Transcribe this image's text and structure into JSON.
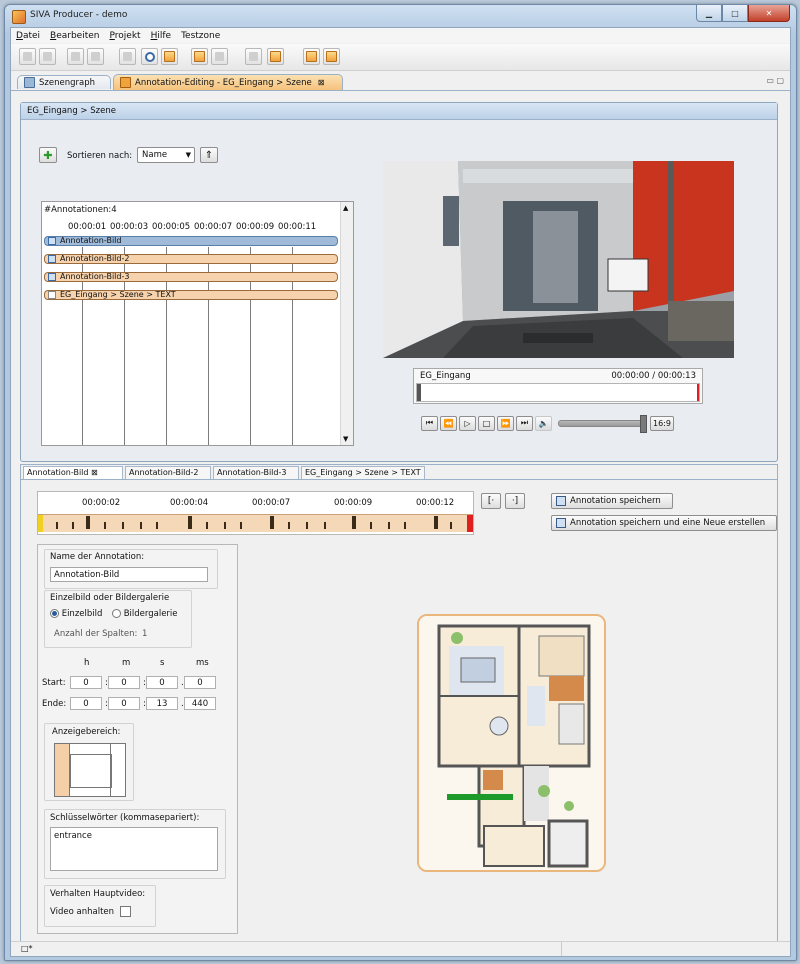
{
  "window": {
    "title": "SIVA Producer - demo"
  },
  "menu": [
    {
      "label": "Datei",
      "u": "D",
      "rest": "atei"
    },
    {
      "label": "Bearbeiten",
      "u": "B",
      "rest": "earbeiten"
    },
    {
      "label": "Projekt",
      "u": "P",
      "rest": "rojekt"
    },
    {
      "label": "Hilfe",
      "u": "H",
      "rest": "ilfe"
    },
    {
      "label": "Testzone",
      "u": "",
      "rest": "Testzone"
    }
  ],
  "tabs": {
    "scenegraph": "Szenengraph",
    "editing": "Annotation-Editing - EG_Eingang > Szene"
  },
  "editor": {
    "header": "EG_Eingang > Szene",
    "sort_label": "Sortieren nach:",
    "sort_value": "Name"
  },
  "annotations": {
    "count_label": "#Annotationen:4",
    "times": [
      "00:00:01",
      "00:00:03",
      "00:00:05",
      "00:00:07",
      "00:00:09",
      "00:00:11"
    ],
    "items": [
      {
        "label": "Annotation-Bild",
        "selected": true
      },
      {
        "label": "Annotation-Bild-2",
        "selected": false
      },
      {
        "label": "Annotation-Bild-3",
        "selected": false
      },
      {
        "label": "EG_Eingang > Szene > TEXT",
        "selected": false
      }
    ]
  },
  "player": {
    "video_name": "EG_Eingang",
    "time": "00:00:00 / 00:00:13",
    "aspect": "16:9"
  },
  "subtabs": [
    "Annotation-Bild",
    "Annotation-Bild-2",
    "Annotation-Bild-3",
    "EG_Eingang > Szene > TEXT"
  ],
  "timeline": {
    "times": [
      "00:00:02",
      "00:00:04",
      "00:00:07",
      "00:00:09",
      "00:00:12"
    ]
  },
  "actions": {
    "save": "Annotation speichern",
    "save_new": "Annotation speichern und eine Neue erstellen"
  },
  "form": {
    "name_label": "Name der Annotation:",
    "name_value": "Annotation-Bild",
    "mode_label": "Einzelbild oder Bildergalerie",
    "single": "Einzelbild",
    "gallery": "Bildergalerie",
    "columns_label": "Anzahl der Spalten:",
    "columns_value": "1",
    "h": "h",
    "m": "m",
    "s": "s",
    "ms": "ms",
    "start_label": "Start:",
    "start": [
      "0",
      "0",
      "0",
      "0"
    ],
    "end_label": "Ende:",
    "end": [
      "0",
      "0",
      "13",
      "440"
    ],
    "area_label": "Anzeigebereich:",
    "keywords_label": "Schlüsselwörter (kommasepariert):",
    "keywords_value": "entrance",
    "behavior_label": "Verhalten Hauptvideo:",
    "pause_label": "Video anhalten"
  },
  "colors": {
    "accent_orange": "#f6c27c",
    "selected_blue": "#9fbbd9",
    "playhead_red": "#e02020"
  }
}
